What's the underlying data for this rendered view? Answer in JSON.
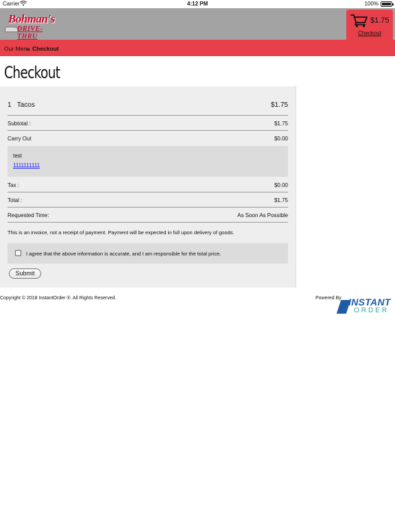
{
  "status_bar": {
    "carrier": "Carrier",
    "time": "4:12 PM",
    "battery": "100%"
  },
  "header": {
    "brand": "Bohman's",
    "tagline": "DRIVE-THRU",
    "cart_total": "$1.75",
    "cart_link": "Checkout"
  },
  "breadcrumb": {
    "items": [
      "Our Menu",
      "Checkout"
    ],
    "separator": "»"
  },
  "page_title": "Checkout",
  "order": {
    "item": {
      "qty": "1",
      "name": "Tacos",
      "price": "$1.75"
    },
    "subtotal_label": "Subtotal :",
    "subtotal_value": "$1.75",
    "carry_out_label": "Carry Out",
    "carry_out_value": "$0.00",
    "customer": {
      "name": "test",
      "phone": "1111111111"
    },
    "tax_label": "Tax :",
    "tax_value": "$0.00",
    "total_label": "Total :",
    "total_value": "$1.75",
    "requested_time_label": "Requested Time:",
    "requested_time_value": "As Soon As Possible",
    "invoice_note": "This is an invoice, not a receipt of payment. Payment will be expected in full upon delivery of goods.",
    "agree_text": "I agree that the above information is accurate, and I am responsible for the total price.",
    "agree_checked": false,
    "submit_label": "Submit"
  },
  "footer": {
    "copyright": "Copyright © 2018 InstantOrder ®. All Rights Reserved.",
    "powered_by": "Powered By",
    "logo_word1": "INSTANT",
    "logo_word2": "ORDER"
  },
  "colors": {
    "header_gray": "#a3a3a3",
    "accent_red": "#e8404a",
    "panel_gray": "#eeeeee",
    "brand_red": "#c8102e",
    "io_blue": "#1e5ba8",
    "io_teal": "#2aa89a"
  }
}
